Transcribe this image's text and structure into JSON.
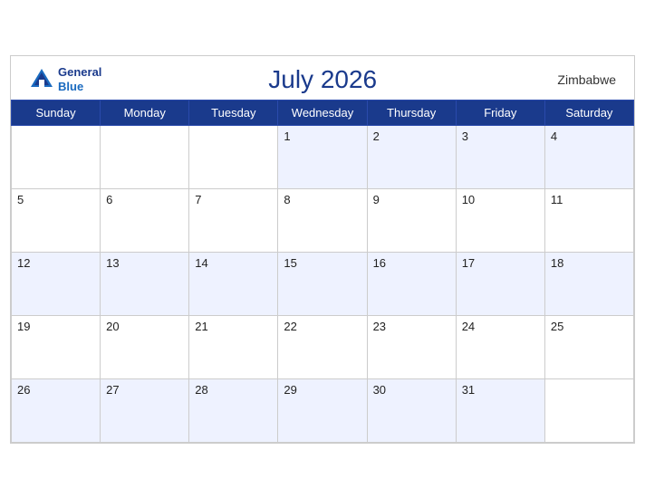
{
  "header": {
    "logo_general": "General",
    "logo_blue": "Blue",
    "title": "July 2026",
    "country": "Zimbabwe"
  },
  "weekdays": [
    "Sunday",
    "Monday",
    "Tuesday",
    "Wednesday",
    "Thursday",
    "Friday",
    "Saturday"
  ],
  "weeks": [
    [
      null,
      null,
      null,
      1,
      2,
      3,
      4
    ],
    [
      5,
      6,
      7,
      8,
      9,
      10,
      11
    ],
    [
      12,
      13,
      14,
      15,
      16,
      17,
      18
    ],
    [
      19,
      20,
      21,
      22,
      23,
      24,
      25
    ],
    [
      26,
      27,
      28,
      29,
      30,
      31,
      null
    ]
  ]
}
